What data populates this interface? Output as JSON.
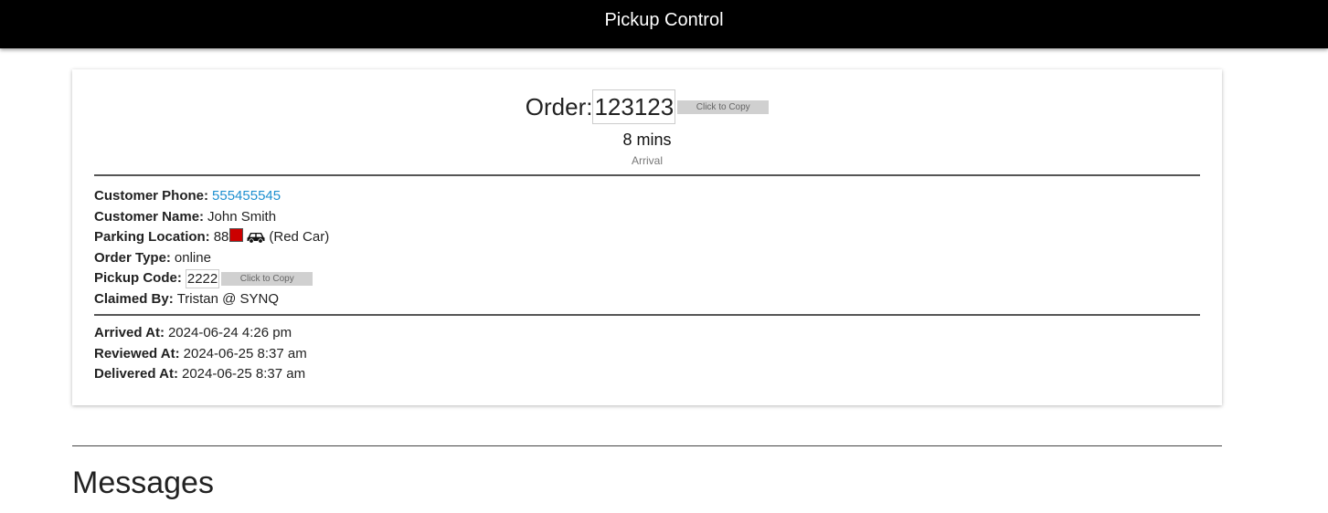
{
  "header": {
    "title": "Pickup Control"
  },
  "order": {
    "label": "Order:",
    "number": "123123",
    "copy_label": "Click to Copy",
    "eta": "8 mins",
    "eta_caption": "Arrival"
  },
  "details": {
    "phone_label": "Customer Phone:",
    "phone_value": "555455545",
    "phone_color": "#1e90d0",
    "name_label": "Customer Name:",
    "name_value": "John Smith",
    "parking_label": "Parking Location:",
    "parking_spot": "88",
    "car_color_swatch": "#cc0000",
    "car_icon": "car-icon",
    "car_desc": "(Red Car)",
    "type_label": "Order Type:",
    "type_value": "online",
    "pickup_label": "Pickup Code:",
    "pickup_value": "2222",
    "pickup_copy_label": "Click to Copy",
    "claimed_label": "Claimed By:",
    "claimed_value": "Tristan @ SYNQ"
  },
  "timeline": {
    "arrived_label": "Arrived At:",
    "arrived_value": "2024-06-24 4:26 pm",
    "reviewed_label": "Reviewed At:",
    "reviewed_value": "2024-06-25 8:37 am",
    "delivered_label": "Delivered At:",
    "delivered_value": "2024-06-25 8:37 am"
  },
  "messages": {
    "title": "Messages"
  }
}
